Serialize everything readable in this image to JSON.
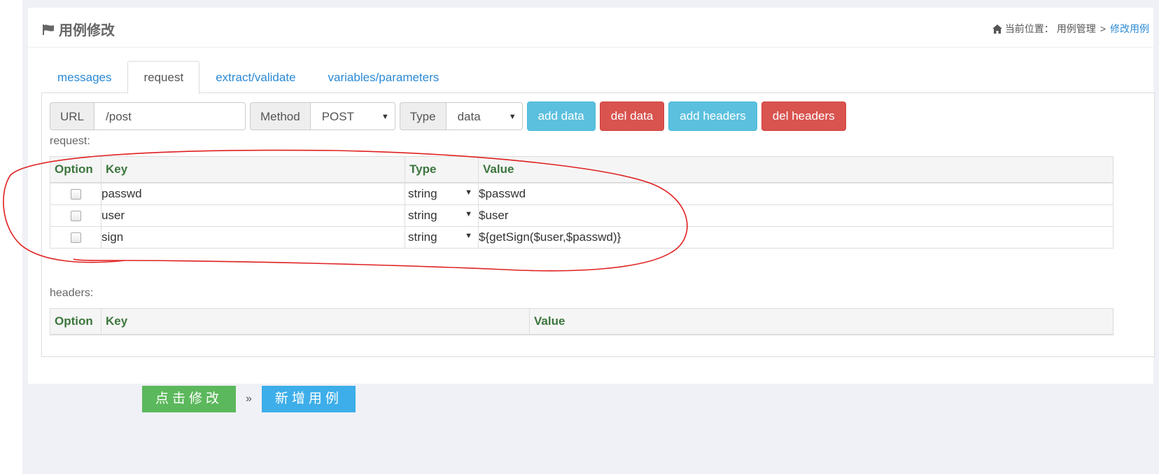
{
  "header": {
    "title": "用例修改",
    "breadcrumb": {
      "prefix": "当前位置：",
      "parent": "用例管理",
      "separator": ">",
      "current": "修改用例"
    }
  },
  "tabs": [
    {
      "label": "messages",
      "active": false
    },
    {
      "label": "request",
      "active": true
    },
    {
      "label": "extract/validate",
      "active": false
    },
    {
      "label": "variables/parameters",
      "active": false
    }
  ],
  "toolbar": {
    "url_label": "URL",
    "url_value": "/post",
    "method_label": "Method",
    "method_value": "POST",
    "type_label": "Type",
    "type_value": "data",
    "add_data": "add data",
    "del_data": "del data",
    "add_headers": "add headers",
    "del_headers": "del headers"
  },
  "request": {
    "label": "request:",
    "columns": [
      "Option",
      "Key",
      "Type",
      "Value"
    ],
    "rows": [
      {
        "key": "passwd",
        "type": "string",
        "value": "$passwd"
      },
      {
        "key": "user",
        "type": "string",
        "value": "$user"
      },
      {
        "key": "sign",
        "type": "string",
        "value": "${getSign($user,$passwd)}"
      }
    ]
  },
  "headers": {
    "label": "headers:",
    "columns": [
      "Option",
      "Key",
      "Value"
    ]
  },
  "actions": {
    "submit": "点击修改",
    "separator": "»",
    "new_case": "新增用例"
  },
  "colors": {
    "accent_link": "#2b8ad6",
    "info": "#5bc0de",
    "danger": "#d9534f",
    "success": "#5cb85c",
    "annotation": "#e02020"
  }
}
